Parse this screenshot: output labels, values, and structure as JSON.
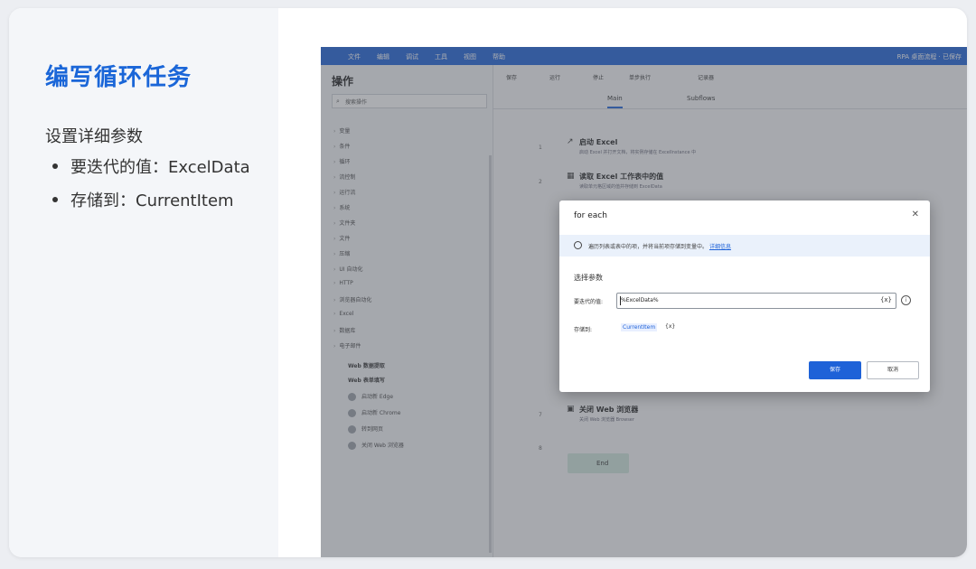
{
  "slide": {
    "title": "编写循环任务",
    "subtitle": "设置详细参数",
    "bullets": [
      "要迭代的值：ExcelData",
      "存储到：CurrentItem"
    ]
  },
  "app": {
    "menu": [
      "文件",
      "编辑",
      "调试",
      "工具",
      "视图",
      "帮助"
    ],
    "menu_right": "RPA 桌面流程 · 已保存",
    "sidebar": {
      "title": "操作",
      "search_placeholder": "搜索操作",
      "groups": [
        "变量",
        "条件",
        "循环",
        "流控制",
        "运行流",
        "系统",
        "文件夹",
        "文件",
        "压缩",
        "UI 自动化",
        "HTTP",
        "浏览器自动化",
        "Excel",
        "数据库",
        "电子邮件"
      ],
      "subgroups": [
        "Web 数据提取",
        "Web 表单填写"
      ],
      "actions": [
        "启动新 Edge",
        "启动新 Chrome",
        "转到网页",
        "关闭 Web 浏览器"
      ]
    },
    "toolbar": [
      "保存",
      "运行",
      "停止",
      "单步执行",
      "记录器"
    ],
    "tabs": [
      "Main",
      "Subflows"
    ],
    "steps": [
      {
        "num": "1",
        "title": "启动 Excel",
        "desc": "启动 Excel 并打开文档，将实例存储在 ExcelInstance 中"
      },
      {
        "num": "2",
        "title": "读取 Excel 工作表中的值",
        "desc": "读取单元格区域的值并存储到 ExcelData"
      },
      {
        "num": "7",
        "title": "关闭 Web 浏览器",
        "desc": "关闭 Web 浏览器 Browser"
      }
    ],
    "end_label": "End",
    "end_num": "8"
  },
  "dialog": {
    "title": "for each",
    "info_text": "遍历列表或表中的项，并将当前项存储到变量中。",
    "info_link": "详细信息",
    "section": "选择参数",
    "iterate_label": "要迭代的值:",
    "iterate_value": "%ExcelData%",
    "store_label": "存储到:",
    "store_value": "CurrentItem",
    "save": "保存",
    "cancel": "取消"
  },
  "colors": {
    "accent": "#1a66d8",
    "app_blue": "#1e62d8"
  }
}
